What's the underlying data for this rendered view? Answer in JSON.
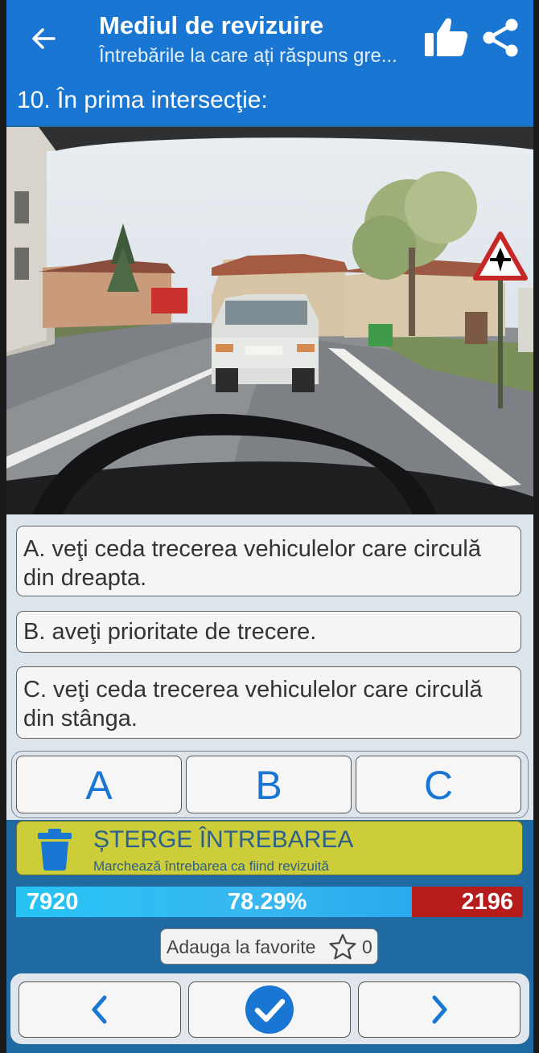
{
  "app_bar": {
    "title": "Mediul de revizuire",
    "subtitle": "Întrebările la care ați răspuns gre..."
  },
  "question": {
    "number_text": "10. În prima intersecţie:"
  },
  "answers": [
    {
      "key": "A",
      "text": "A.  veţi ceda trecerea vehiculelor care circulă din dreapta."
    },
    {
      "key": "B",
      "text": "B.  aveţi prioritate de trecere."
    },
    {
      "key": "C",
      "text": "C. veţi ceda trecerea vehiculelor care circulă din stânga."
    }
  ],
  "choice_buttons": [
    "A",
    "B",
    "C"
  ],
  "delete": {
    "title": "ȘTERGE ÎNTREBAREA",
    "subtitle": "Marchează întrebarea ca fiind revizuită"
  },
  "stats": {
    "correct": "7920",
    "percent": "78.29%",
    "wrong": "2196"
  },
  "favorite": {
    "label": "Adauga la favorite",
    "count": "0"
  },
  "colors": {
    "app_bar": "#1976d2",
    "accent_blue": "#1976d2",
    "delete_bar": "#cdcd3a",
    "correct_bar": "#26c3f4",
    "wrong_bar": "#b71c1c",
    "check_button": "#1976d2"
  },
  "icons": [
    "back-arrow-icon",
    "thumbs-up-icon",
    "share-icon",
    "trash-icon",
    "star-outline-icon",
    "chevron-left-icon",
    "checkmark-circle-icon",
    "chevron-right-icon"
  ]
}
